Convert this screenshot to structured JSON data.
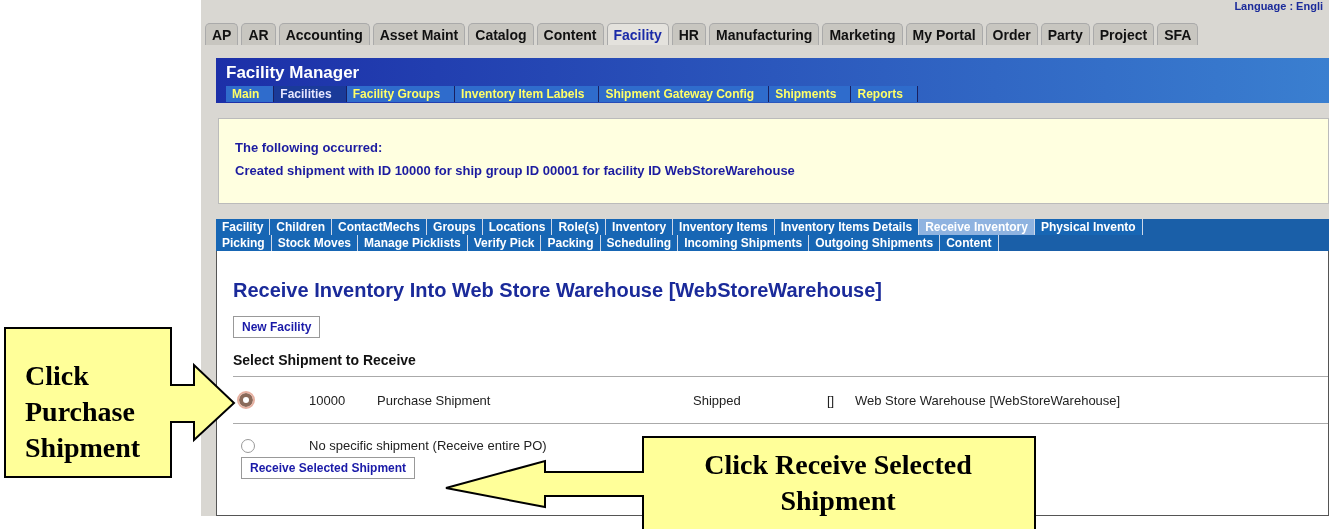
{
  "language_link": "Language : Engli",
  "app_tabs": [
    {
      "label": "AP",
      "selected": false
    },
    {
      "label": "AR",
      "selected": false
    },
    {
      "label": "Accounting",
      "selected": false
    },
    {
      "label": "Asset Maint",
      "selected": false
    },
    {
      "label": "Catalog",
      "selected": false
    },
    {
      "label": "Content",
      "selected": false
    },
    {
      "label": "Facility",
      "selected": true
    },
    {
      "label": "HR",
      "selected": false
    },
    {
      "label": "Manufacturing",
      "selected": false
    },
    {
      "label": "Marketing",
      "selected": false
    },
    {
      "label": "My Portal",
      "selected": false
    },
    {
      "label": "Order",
      "selected": false
    },
    {
      "label": "Party",
      "selected": false
    },
    {
      "label": "Project",
      "selected": false
    },
    {
      "label": "SFA",
      "selected": false
    }
  ],
  "header": {
    "title": "Facility Manager",
    "nav": [
      {
        "label": "Main",
        "selected": false
      },
      {
        "label": "Facilities",
        "selected": true
      },
      {
        "label": "Facility Groups",
        "selected": false
      },
      {
        "label": "Inventory Item Labels",
        "selected": false
      },
      {
        "label": "Shipment Gateway Config",
        "selected": false
      },
      {
        "label": "Shipments",
        "selected": false
      },
      {
        "label": "Reports",
        "selected": false
      }
    ]
  },
  "message": {
    "lines": [
      "The following occurred:",
      "Created shipment with ID 10000 for ship group ID 00001 for facility ID WebStoreWarehouse"
    ]
  },
  "sub_nav": [
    [
      {
        "label": "Facility",
        "selected": false
      },
      {
        "label": "Children",
        "selected": false
      },
      {
        "label": "ContactMechs",
        "selected": false
      },
      {
        "label": "Groups",
        "selected": false
      },
      {
        "label": "Locations",
        "selected": false
      },
      {
        "label": "Role(s)",
        "selected": false
      },
      {
        "label": "Inventory",
        "selected": false
      },
      {
        "label": "Inventory Items",
        "selected": false
      },
      {
        "label": "Inventory Items Details",
        "selected": false
      },
      {
        "label": "Receive Inventory",
        "selected": true
      },
      {
        "label": "Physical Invento",
        "selected": false
      }
    ],
    [
      {
        "label": "Picking",
        "selected": false
      },
      {
        "label": "Stock Moves",
        "selected": false
      },
      {
        "label": "Manage Picklists",
        "selected": false
      },
      {
        "label": "Verify Pick",
        "selected": false
      },
      {
        "label": "Packing",
        "selected": false
      },
      {
        "label": "Scheduling",
        "selected": false
      },
      {
        "label": "Incoming Shipments",
        "selected": false
      },
      {
        "label": "Outgoing Shipments",
        "selected": false
      },
      {
        "label": "Content",
        "selected": false
      }
    ]
  ],
  "page_title": "Receive Inventory Into Web Store Warehouse [WebStoreWarehouse]",
  "new_button": "New Facility",
  "section_title": "Select Shipment to Receive",
  "shipments": [
    {
      "selected": true,
      "id": "10000",
      "type": "Purchase Shipment",
      "status": "Shipped",
      "column_4": "[]",
      "facility": "Web Store Warehouse [WebStoreWarehouse]"
    }
  ],
  "no_shipment_option": {
    "label": "No specific shipment (Receive entire PO)",
    "selected": false
  },
  "submit_button": "Receive Selected Shipment",
  "callouts": [
    {
      "text": "Click Purchase Shipment"
    },
    {
      "text": "Click Receive Selected Shipment"
    }
  ]
}
